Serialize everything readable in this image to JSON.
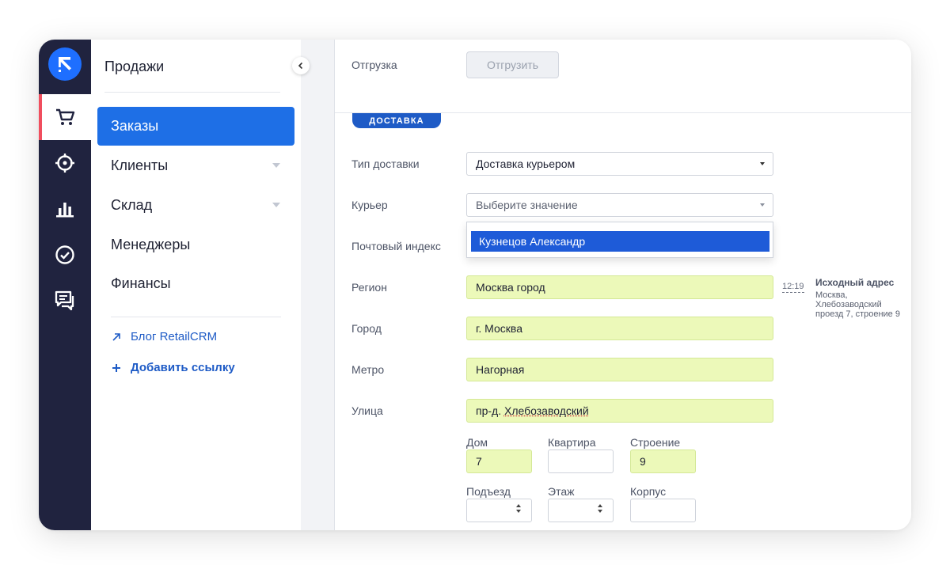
{
  "sidebar": {
    "title": "Продажи",
    "items": [
      {
        "label": "Заказы"
      },
      {
        "label": "Клиенты"
      },
      {
        "label": "Склад"
      },
      {
        "label": "Менеджеры"
      },
      {
        "label": "Финансы"
      }
    ],
    "links": [
      {
        "label": "Блог RetailCRM",
        "icon": "external-link-arrow-icon"
      },
      {
        "label": "Добавить ссылку",
        "icon": "plus-icon"
      }
    ]
  },
  "rail": {
    "icons": [
      "retailcrm-logo",
      "cart-icon",
      "target-icon",
      "bar-chart-icon",
      "check-circle-icon",
      "chat-icon"
    ]
  },
  "shipment": {
    "label": "Отгрузка",
    "button": "Отгрузить"
  },
  "delivery": {
    "section_title": "ДОСТАВКА",
    "type_label": "Тип доставки",
    "type_value": "Доставка курьером",
    "courier_label": "Курьер",
    "courier_placeholder": "Выберите значение",
    "courier_option": "Кузнецов Александр",
    "postal_label": "Почтовый индекс",
    "region_label": "Регион",
    "region_value": "Москва город",
    "city_label": "Город",
    "city_value": "г. Москва",
    "metro_label": "Метро",
    "metro_value": "Нагорная",
    "street_label": "Улица",
    "street_prefix": "пр-д.",
    "street_name": "Хлебозаводский",
    "time": "12:19",
    "source_address_title": "Исходный адрес",
    "source_address_text": "Москва, Хлебозаводский проезд 7, строение 9",
    "house_label": "Дом",
    "house_value": "7",
    "flat_label": "Квартира",
    "flat_value": "",
    "building_label": "Строение",
    "building_value": "9",
    "entrance_label": "Подъезд",
    "floor_label": "Этаж",
    "block_label": "Корпус"
  },
  "colors": {
    "rail_bg": "#20233f",
    "accent": "#1e6fe6",
    "active_marker": "#f04e5e",
    "filled_field": "#ecf9b9"
  }
}
